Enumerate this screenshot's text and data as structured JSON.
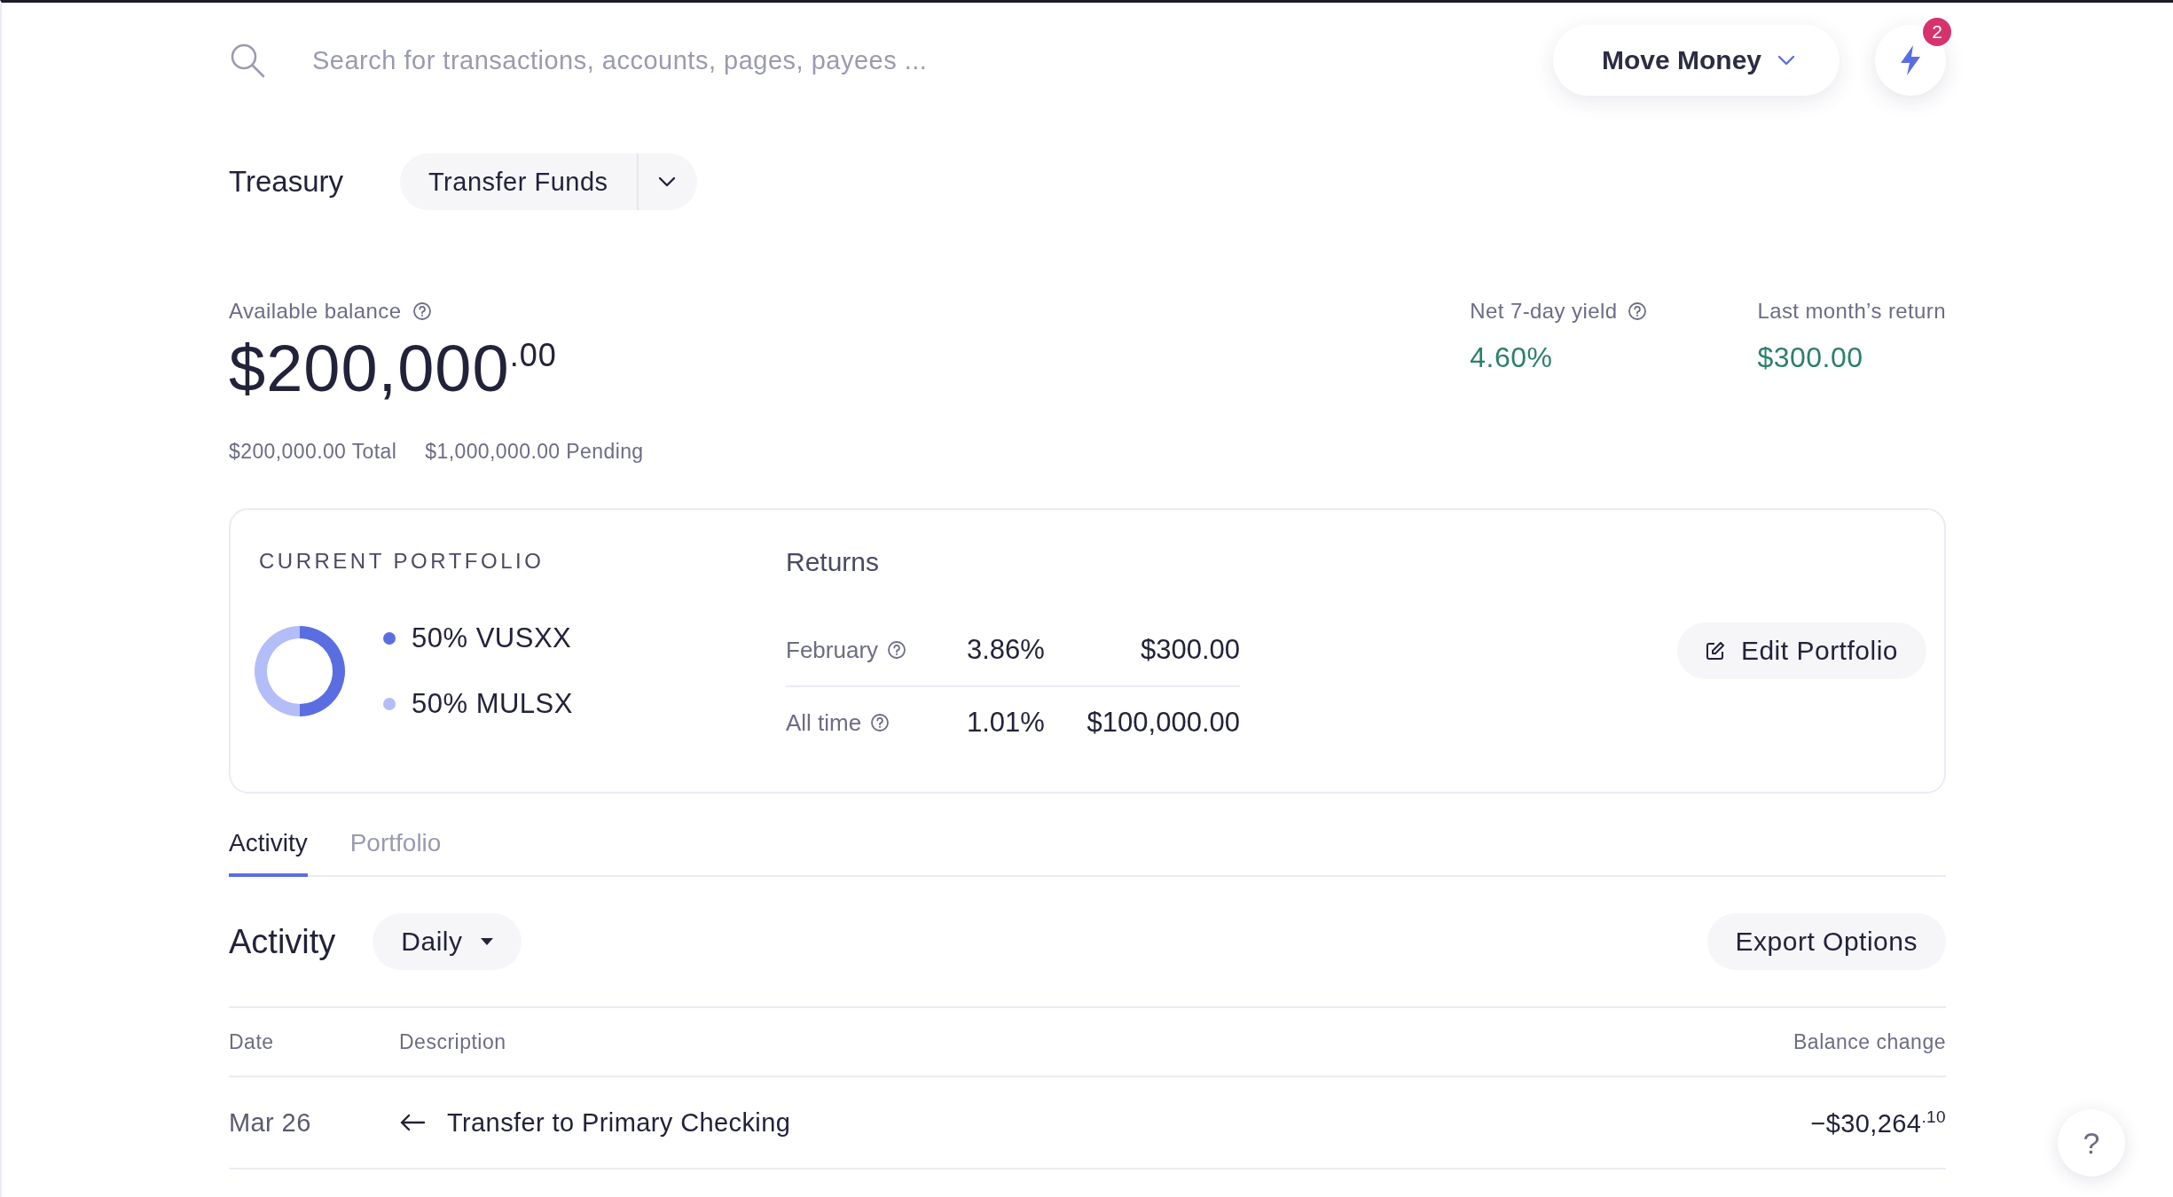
{
  "search": {
    "placeholder": "Search for transactions, accounts, pages, payees ..."
  },
  "move_money": {
    "label": "Move Money"
  },
  "notifications": {
    "count": "2"
  },
  "page": {
    "title": "Treasury",
    "action": "Transfer Funds"
  },
  "balance": {
    "label": "Available balance",
    "amount": "$200,000$^{.00}$",
    "total": "$200,000.00 Total",
    "pending": "$1,000,000.00 Pending"
  },
  "stats": [
    {
      "label": "Net 7-day yield",
      "value": "4.60%",
      "help": true
    },
    {
      "label": "Last month’s return",
      "value": "$300.00",
      "help": false
    }
  ],
  "portfolio": {
    "title": "CURRENT PORTFOLIO",
    "holdings": [
      {
        "percent": "50%",
        "color": "#5b6ee1"
      },
      {
        "percent": "50%",
        "color": "#b3bdf7"
      }
    ],
    "chart_data": {
      "type": "donut",
      "categories": [
        "VUSXX",
        "MULSX"
      ],
      "values": [
        50,
        50
      ]
    },
    "returns_title": "Returns",
    "returns": [
      {
        "period": "February",
        "percent": "3.86%",
        "amount": "$300.00"
      },
      {
        "period": "All time",
        "percent": "1.01%",
        "amount": "$100,000.00"
      }
    ],
    "edit_button": "Edit Portfolio"
  },
  "tabs": [
    {
      "label": "Activity",
      "selected": true
    },
    {
      "label": "Portfolio",
      "selected": false
    }
  ],
  "activity": {
    "title": "Activity",
    "interval": "Daily",
    "export_button": "Export Options",
    "columns": [
      "Date",
      "Description",
      "Balance change"
    ],
    "rows": [
      {
        "date": "Mar 26",
        "description": "Transfer to Primary Checking",
        "amount": "−$30,264$^{.10}$"
      }
    ]
  },
  "help_button": "?"
}
